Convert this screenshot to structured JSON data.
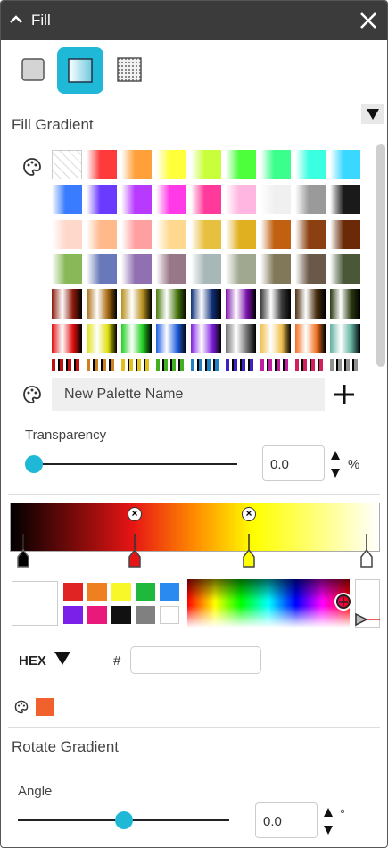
{
  "header": {
    "title": "Fill"
  },
  "fill_types": [
    {
      "name": "solid"
    },
    {
      "name": "gradient",
      "active": true
    },
    {
      "name": "pattern"
    }
  ],
  "gradient_section": {
    "title": "Fill Gradient",
    "palette_placeholder": "New Palette Name"
  },
  "transparency": {
    "label": "Transparency",
    "value": "0.0",
    "unit": "%",
    "level": 0
  },
  "color_picker": {
    "mode_label": "HEX",
    "hash": "#",
    "hex_value": "",
    "current_color": "#f0612d",
    "quick_colors": [
      "#e02424",
      "#ee8020",
      "#f7f72a",
      "#1eb83c",
      "#2b8af0",
      "#7a20e8",
      "#e8197a",
      "#111111",
      "#808080",
      "#ffffff"
    ]
  },
  "rotate_section": {
    "title": "Rotate Gradient",
    "angle_label": "Angle",
    "angle_value": "0.0",
    "angle_unit": "°",
    "level": 0.5
  },
  "colors": {
    "accent": "#1fb8d6",
    "titlebar": "#3b3b3b"
  }
}
